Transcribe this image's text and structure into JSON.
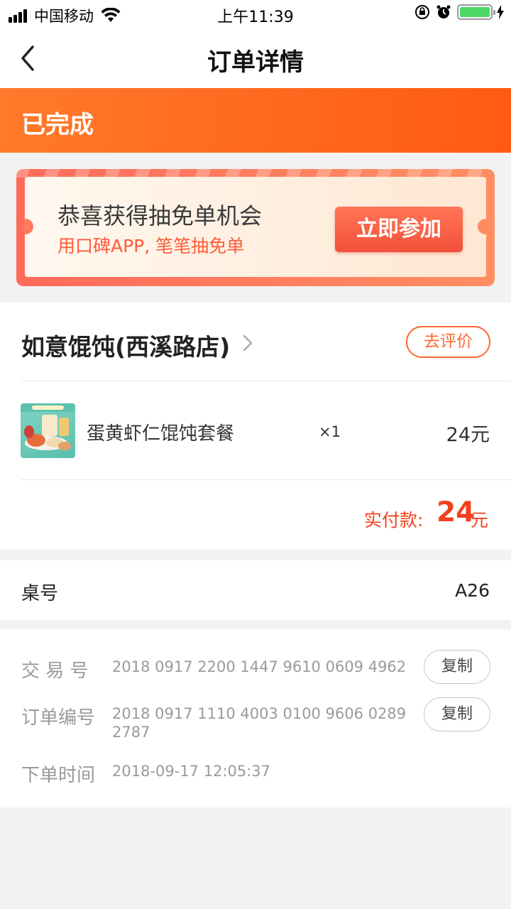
{
  "status_bar": {
    "carrier": "中国移动",
    "time": "上午11:39"
  },
  "nav": {
    "title": "订单详情"
  },
  "order_status": "已完成",
  "promo": {
    "title": "恭喜获得抽免单机会",
    "subtitle": "用口碑APP, 笔笔抽免单",
    "button": "立即参加"
  },
  "shop": {
    "name": "如意馄饨(西溪路店)",
    "review_button": "去评价"
  },
  "items": [
    {
      "name": "蛋黄虾仁馄饨套餐",
      "qty": "×1",
      "price": "24元"
    }
  ],
  "payment": {
    "label": "实付款:",
    "amount": "24",
    "unit": "元"
  },
  "table": {
    "label": "桌号",
    "value": "A26"
  },
  "info": {
    "trade_no_label": "交 易 号",
    "trade_no": "2018 0917 2200 1447 9610 0609 4962",
    "order_no_label": "订单编号",
    "order_no_line1": "2018 0917 1110 4003 0100 9606 0289",
    "order_no_line2": "2787",
    "time_label": "下单时间",
    "time": "2018-09-17 12:05:37",
    "copy_label": "复制"
  },
  "colors": {
    "accent": "#ff5a14",
    "price_red": "#f2401f",
    "battery_green": "#4cd964"
  }
}
